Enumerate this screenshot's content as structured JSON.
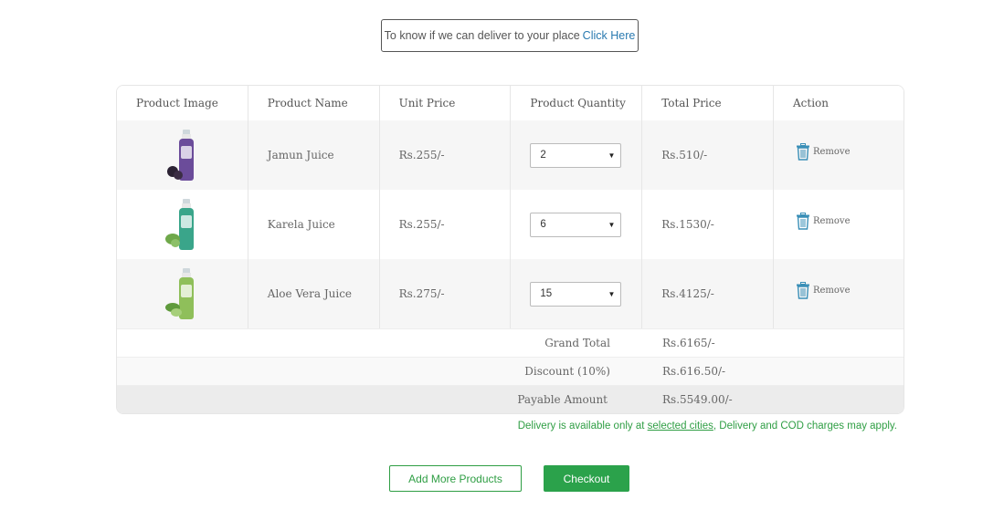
{
  "delivery_check": {
    "text": "To know if we can deliver to your place",
    "link": "Click Here"
  },
  "table": {
    "headers": [
      "Product Image",
      "Product Name",
      "Unit Price",
      "Product Quantity",
      "Total Price",
      "Action"
    ],
    "rows": [
      {
        "name": "Jamun Juice",
        "unit_price": "Rs.255/-",
        "quantity": "2",
        "total": "Rs.510/-",
        "action": "Remove",
        "image": "jamun-juice-bottle",
        "color": "#6b4c9a"
      },
      {
        "name": "Karela Juice",
        "unit_price": "Rs.255/-",
        "quantity": "6",
        "total": "Rs.1530/-",
        "action": "Remove",
        "image": "karela-juice-bottle",
        "color": "#3aa58a"
      },
      {
        "name": "Aloe Vera Juice",
        "unit_price": "Rs.275/-",
        "quantity": "15",
        "total": "Rs.4125/-",
        "action": "Remove",
        "image": "aloe-vera-juice-bottle",
        "color": "#8fbf5a"
      }
    ]
  },
  "summary": {
    "grand_total_label": "Grand Total",
    "grand_total_value": "Rs.6165/-",
    "discount_label": "Discount (10%)",
    "discount_value": "Rs.616.50/-",
    "payable_label": "Payable Amount",
    "payable_value": "Rs.5549.00/-"
  },
  "delivery_note": {
    "prefix": "Delivery is available only at",
    "link": "selected cities",
    "suffix": ", Delivery and COD charges may apply."
  },
  "buttons": {
    "add_more": "Add More Products",
    "checkout": "Checkout"
  },
  "colors": {
    "accent_green": "#2ba24b",
    "link_blue": "#2a7ab0",
    "trash_blue": "#3a8fb7"
  }
}
